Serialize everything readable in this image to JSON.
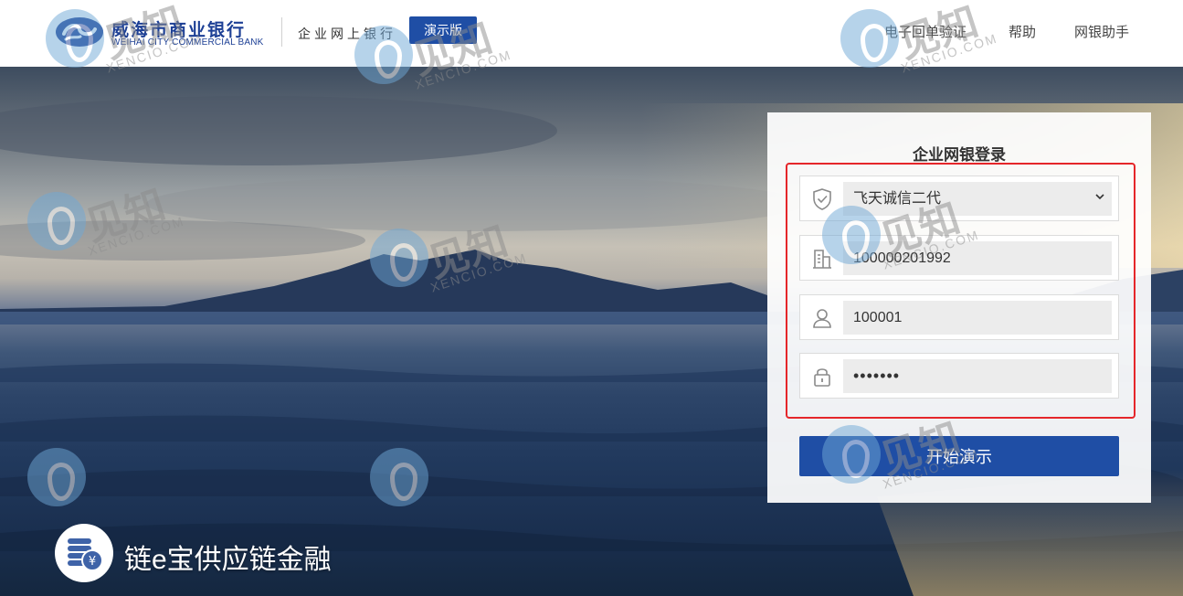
{
  "header": {
    "logo_cn": "威海市商业银行",
    "logo_en": "WEIHAI CITY COMMERCIAL BANK",
    "subtitle": "企业网上银行",
    "demo_badge": "演示版",
    "nav": [
      "电子回单验证",
      "帮助",
      "网银助手"
    ]
  },
  "login": {
    "title": "企业网银登录",
    "cert_type": {
      "icon": "shield-check-icon",
      "value": "飞天诚信二代",
      "dropdown_icon": "chevron-down-icon"
    },
    "enterprise_id": {
      "icon": "building-icon",
      "value": "100000201992"
    },
    "user_id": {
      "icon": "user-icon",
      "value": "100001"
    },
    "password": {
      "icon": "lock-icon",
      "value": "•••••••"
    },
    "submit_label": "开始演示"
  },
  "promo": {
    "icon": "coin-stack-yuan-icon",
    "text": "链e宝供应链金融"
  },
  "watermark": {
    "cn": "见知",
    "en": "XENCIO.COM"
  },
  "colors": {
    "brand_blue": "#1f4ea5",
    "logo_blue": "#1c3f95",
    "highlight_red": "#e5262a"
  }
}
